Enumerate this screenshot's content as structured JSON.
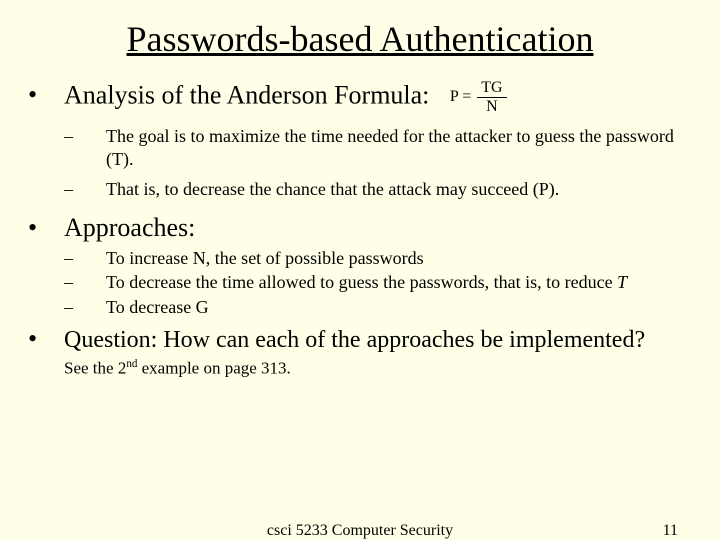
{
  "title": "Passwords-based Authentication",
  "bullets": {
    "analysis": {
      "label": "Analysis of the Anderson Formula:",
      "formula_lhs": "P =",
      "formula_num": "TG",
      "formula_den": "N",
      "subs": [
        "The goal is to maximize the time needed for the attacker to guess the password (T).",
        "That is, to decrease the chance that the attack may succeed (P)."
      ]
    },
    "approaches": {
      "label": "Approaches:",
      "subs": [
        "To increase N, the set of possible passwords",
        "To decrease the time allowed to guess the passwords, that is, to reduce ",
        "To decrease G"
      ],
      "t_ital": "T"
    },
    "question": "Question: How can each of the approaches be implemented?",
    "example_pre": "See the 2",
    "example_sup": "nd",
    "example_post": " example on page 313."
  },
  "footer": {
    "center": "csci 5233 Computer Security",
    "page": "11"
  }
}
